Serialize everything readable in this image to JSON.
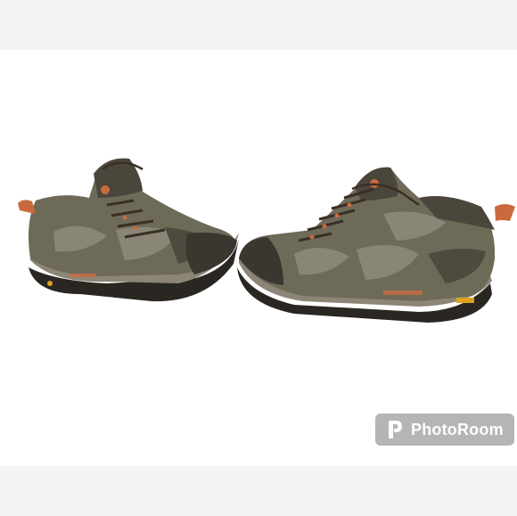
{
  "photo": {
    "subject_icon": "hiking-shoes",
    "colors": {
      "background": "#ffffff",
      "outer_band": "#f3f3f3",
      "suede": "#6e6a58",
      "mesh": "#8a8676",
      "sole": "#2a2622",
      "accent": "#c96a3e"
    }
  },
  "watermark": {
    "label": "PhotoRoom",
    "icon": "photoroom-logo-icon"
  }
}
